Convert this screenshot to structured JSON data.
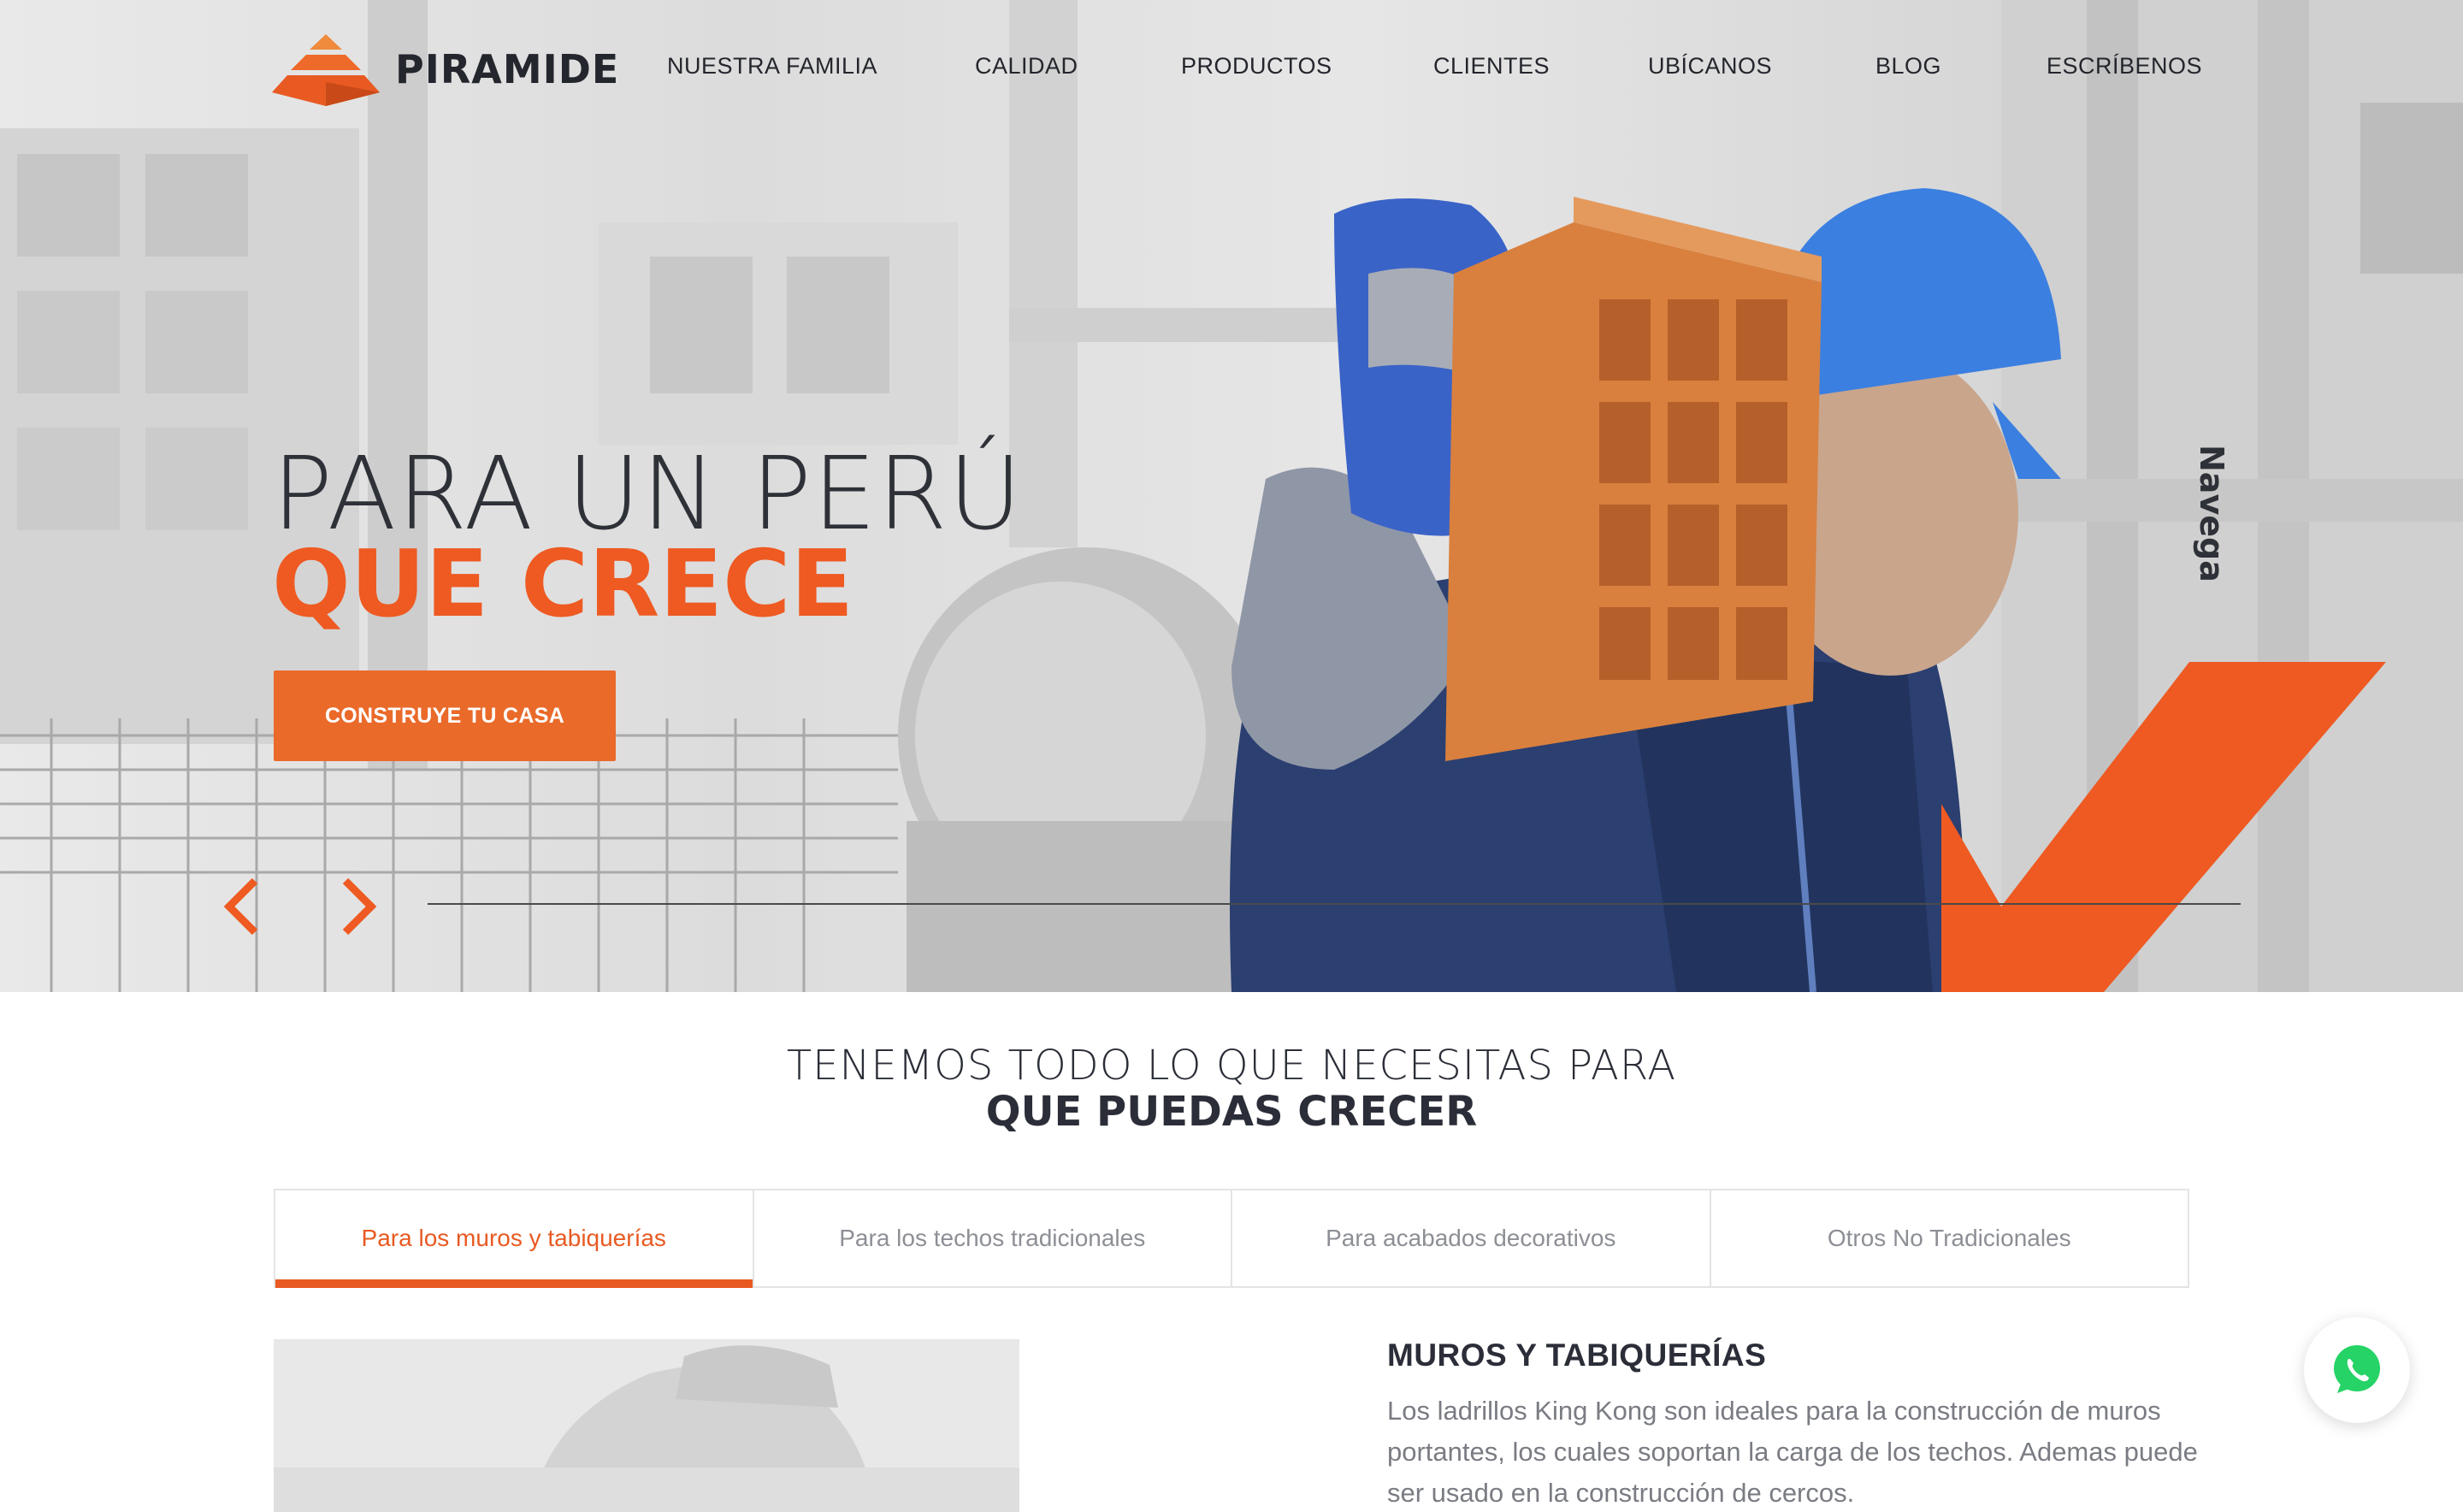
{
  "brand": {
    "name": "PIRAMIDE",
    "accent": "#ee5a22",
    "dark": "#24262d"
  },
  "nav": {
    "items": [
      {
        "label": "NUESTRA FAMILIA"
      },
      {
        "label": "CALIDAD"
      },
      {
        "label": "PRODUCTOS"
      },
      {
        "label": "CLIENTES"
      },
      {
        "label": "UBÍCANOS"
      },
      {
        "label": "BLOG"
      },
      {
        "label": "ESCRÍBENOS"
      }
    ]
  },
  "hero": {
    "title_line1": "PARA UN PERÚ",
    "title_line2": "QUE CRECE",
    "cta_label": "CONSTRUYE TU CASA",
    "side_label": "Navega",
    "prev_icon": "chevron-left-icon",
    "next_icon": "chevron-right-icon"
  },
  "section": {
    "title_line1": "TENEMOS TODO LO QUE NECESITAS PARA",
    "title_line2": "QUE PUEDAS CRECER"
  },
  "tabs": [
    {
      "label": "Para los muros y tabiquerías",
      "active": true
    },
    {
      "label": "Para los techos tradicionales",
      "active": false
    },
    {
      "label": "Para acabados decorativos",
      "active": false
    },
    {
      "label": "Otros No Tradicionales",
      "active": false
    }
  ],
  "content": {
    "title": "MUROS Y TABIQUERÍAS",
    "body": "Los ladrillos King Kong son ideales para la construcción de muros portantes, los cuales soportan la carga de los techos. Ademas puede ser usado en la construcción de cercos."
  },
  "whatsapp": {
    "icon": "whatsapp-icon",
    "color": "#25d366"
  }
}
